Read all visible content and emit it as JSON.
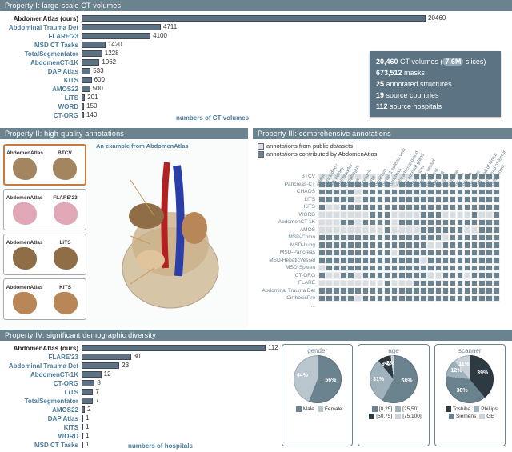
{
  "prop1": {
    "title": "Property I: large-scale CT volumes",
    "axis_note": "numbers of CT volumes",
    "max": 20460,
    "bars": [
      {
        "label": "AbdomenAtlas (ours)",
        "value": 20460,
        "cls": "ours"
      },
      {
        "label": "Abdominal Trauma Det",
        "value": 4711,
        "cls": "link"
      },
      {
        "label": "FLARE'23",
        "value": 4100,
        "cls": "link"
      },
      {
        "label": "MSD CT Tasks",
        "value": 1420,
        "cls": "link"
      },
      {
        "label": "TotalSegmentator",
        "value": 1228,
        "cls": "link"
      },
      {
        "label": "AbdomenCT-1K",
        "value": 1062,
        "cls": "link"
      },
      {
        "label": "DAP Atlas",
        "value": 533,
        "cls": "link"
      },
      {
        "label": "KiTS",
        "value": 600,
        "cls": "link"
      },
      {
        "label": "AMOS22",
        "value": 500,
        "cls": "link"
      },
      {
        "label": "LiTS",
        "value": 201,
        "cls": "link"
      },
      {
        "label": "WORD",
        "value": 150,
        "cls": "link"
      },
      {
        "label": "CT-ORG",
        "value": 140,
        "cls": "link"
      }
    ],
    "stats": {
      "line1a": "20,460",
      "line1b": " CT volumes ",
      "line1c": "7.6M",
      "line1d": " slices",
      "line2a": "673,512",
      "line2b": " masks",
      "line3a": "25",
      "line3b": " annotated structures",
      "line4a": "19",
      "line4b": " source countries",
      "line5a": "112",
      "line5b": " source hospitals"
    }
  },
  "prop2": {
    "title": "Property II: high-quality annotations",
    "caption": "An example from AbdomenAtlas",
    "pairs": [
      {
        "a": "AbdomenAtlas",
        "b": "BTCV",
        "colorA": "#a3865f",
        "colorB": "#a3865f"
      },
      {
        "a": "AbdomenAtlas",
        "b": "FLARE'23",
        "colorA": "#e0a7b6",
        "colorB": "#e0a7b6"
      },
      {
        "a": "AbdomenAtlas",
        "b": "LiTS",
        "colorA": "#8f6d47",
        "colorB": "#8f6d47"
      },
      {
        "a": "AbdomenAtlas",
        "b": "KiTS",
        "colorA": "#b98658",
        "colorB": "#b98658"
      }
    ]
  },
  "prop3": {
    "title": "Property III: comprehensive annotations",
    "legend_public": "annotations from public datasets",
    "legend_ours": "annotations contributed by AbdomenAtlas",
    "columns": [
      "spleen",
      "right kidney",
      "left kidney",
      "gall bladder",
      "esophagus",
      "liver",
      "stomach",
      "aorta",
      "postcava",
      "portal & splenic vein",
      "pancreas",
      "right adrenal gland",
      "left adrenal gland",
      "duodenum",
      "hepatic vessel",
      "right lung",
      "left lung",
      "colon",
      "intestine",
      "rectum",
      "bladder",
      "prostate",
      "left head of femur",
      "right head of femur",
      "celiac trunk"
    ],
    "rows": [
      {
        "label": "BTCV",
        "cells": "p p p p p p p p p p p p p a a a a a a a a a a a a"
      },
      {
        "label": "Pancreas-CT",
        "cells": "a a a a a a a a a a p a a a a a a a a a a a a a a"
      },
      {
        "label": "CHAOS",
        "cells": "a a a a a p a a a a a a a a a a a a a a a a a a a"
      },
      {
        "label": "LiTS",
        "cells": "a a a a a p a a a a a a a a a a a a a a a a a a a"
      },
      {
        "label": "KiTS",
        "cells": "a p p a a a a a a a a a a a a a a a a a a a a a a"
      },
      {
        "label": "WORD",
        "cells": "p p p p p p p a a a p p p p a a a p p p p a p p a"
      },
      {
        "label": "AbdomenCT-1K",
        "cells": "p p p a a p a a a a p a a a a a a a a a a a a a a"
      },
      {
        "label": "AMOS",
        "cells": "p p p p p p p p p a p p p p a a a a a a p p a a a"
      },
      {
        "label": "MSD-Colon",
        "cells": "a a a a a a a a a a a a a a a a a p a a a a a a a"
      },
      {
        "label": "MSD-Lung",
        "cells": "a a a a a a a a a a a a a a a p p a a a a a a a a"
      },
      {
        "label": "MSD-Pancreas",
        "cells": "a a a a a a a a a a p a a a a a a a a a a a a a a"
      },
      {
        "label": "MSD-HepaticVessel",
        "cells": "a a a a a a a a a a a a a a p a a a a a a a a a a"
      },
      {
        "label": "MSD-Spleen",
        "cells": "p a a a a a a a a a a a a a a a a a a a a a a a a"
      },
      {
        "label": "CT-ORG",
        "cells": "a p p a a p a a a a a a a a a p p a a a p a a a a"
      },
      {
        "label": "FLARE",
        "cells": "p p p p p p p p p a p p p a a a a a a a a a a a a"
      },
      {
        "label": "Abdominal Trauma Det",
        "cells": "a a a a a a a a a a a a a a a a a a a a a a a a a"
      },
      {
        "label": "CirrhosisPro",
        "cells": "a a a a a p a a a a a a a a a a a a a a a a a a a"
      },
      {
        "label": "...",
        "cells": ""
      }
    ]
  },
  "prop4": {
    "title": "Property IV: significant demographic diversity",
    "axis_note": "numbers of hospitals",
    "max": 112,
    "bars": [
      {
        "label": "AbdomenAtlas (ours)",
        "value": 112,
        "cls": "ours"
      },
      {
        "label": "FLARE'23",
        "value": 30,
        "cls": "link"
      },
      {
        "label": "Abdominal Trauma Det",
        "value": 23,
        "cls": "link"
      },
      {
        "label": "AbdomenCT-1K",
        "value": 12,
        "cls": "link"
      },
      {
        "label": "CT-ORG",
        "value": 8,
        "cls": "link"
      },
      {
        "label": "LiTS",
        "value": 7,
        "cls": "link"
      },
      {
        "label": "TotalSegmentator",
        "value": 7,
        "cls": "link"
      },
      {
        "label": "AMOS22",
        "value": 2,
        "cls": "link"
      },
      {
        "label": "DAP Atlas",
        "value": 1,
        "cls": "link"
      },
      {
        "label": "KiTS",
        "value": 1,
        "cls": "link"
      },
      {
        "label": "WORD",
        "value": 1,
        "cls": "link"
      },
      {
        "label": "MSD CT Tasks",
        "value": 1,
        "cls": "link"
      }
    ],
    "pies": [
      {
        "title": "gender",
        "slices": [
          {
            "label": "56%",
            "value": 56,
            "color": "#6b828f"
          },
          {
            "label": "44%",
            "value": 44,
            "color": "#b9c6ce"
          }
        ],
        "legend": [
          {
            "k": "#6b828f",
            "t": "Male"
          },
          {
            "k": "#b9c6ce",
            "t": "Female"
          }
        ]
      },
      {
        "title": "age",
        "slices": [
          {
            "label": "58%",
            "value": 58,
            "color": "#6b828f"
          },
          {
            "label": "31%",
            "value": 31,
            "color": "#9fb1bb"
          },
          {
            "label": "9%",
            "value": 9,
            "color": "#2e3a41"
          },
          {
            "label": "2%",
            "value": 2,
            "color": "#c9d3d9"
          }
        ],
        "legend": [
          {
            "k": "#6b828f",
            "t": "[0,25]"
          },
          {
            "k": "#9fb1bb",
            "t": "[25,50]"
          },
          {
            "k": "#2e3a41",
            "t": "[50,75]"
          },
          {
            "k": "#c9d3d9",
            "t": "[75,100]"
          }
        ]
      },
      {
        "title": "scanner",
        "slices": [
          {
            "label": "39%",
            "value": 39,
            "color": "#2e3a41"
          },
          {
            "label": "38%",
            "value": 38,
            "color": "#6b828f"
          },
          {
            "label": "12%",
            "value": 12,
            "color": "#9fb1bb"
          },
          {
            "label": "11%",
            "value": 11,
            "color": "#c9d3d9"
          }
        ],
        "legend": [
          {
            "k": "#2e3a41",
            "t": "Toshiba"
          },
          {
            "k": "#9fb1bb",
            "t": "Phillips"
          },
          {
            "k": "#6b828f",
            "t": "Siemens"
          },
          {
            "k": "#c9d3d9",
            "t": "GE"
          }
        ]
      }
    ]
  },
  "chart_data": [
    {
      "type": "bar",
      "title": "Property I: large-scale CT volumes",
      "xlabel": "numbers of CT volumes",
      "categories": [
        "AbdomenAtlas (ours)",
        "Abdominal Trauma Det",
        "FLARE'23",
        "MSD CT Tasks",
        "TotalSegmentator",
        "AbdomenCT-1K",
        "DAP Atlas",
        "KiTS",
        "AMOS22",
        "LiTS",
        "WORD",
        "CT-ORG"
      ],
      "values": [
        20460,
        4711,
        4100,
        1420,
        1228,
        1062,
        533,
        600,
        500,
        201,
        150,
        140
      ]
    },
    {
      "type": "bar",
      "title": "Property IV: significant demographic diversity",
      "xlabel": "numbers of hospitals",
      "categories": [
        "AbdomenAtlas (ours)",
        "FLARE'23",
        "Abdominal Trauma Det",
        "AbdomenCT-1K",
        "CT-ORG",
        "LiTS",
        "TotalSegmentator",
        "AMOS22",
        "DAP Atlas",
        "KiTS",
        "WORD",
        "MSD CT Tasks"
      ],
      "values": [
        112,
        30,
        23,
        12,
        8,
        7,
        7,
        2,
        1,
        1,
        1,
        1
      ]
    },
    {
      "type": "pie",
      "title": "gender",
      "categories": [
        "Male",
        "Female"
      ],
      "values": [
        56,
        44
      ]
    },
    {
      "type": "pie",
      "title": "age",
      "categories": [
        "[0,25]",
        "[25,50]",
        "[50,75]",
        "[75,100]"
      ],
      "values": [
        58,
        31,
        9,
        2
      ]
    },
    {
      "type": "pie",
      "title": "scanner",
      "categories": [
        "Toshiba",
        "Siemens",
        "Phillips",
        "GE"
      ],
      "values": [
        39,
        38,
        12,
        11
      ]
    }
  ]
}
